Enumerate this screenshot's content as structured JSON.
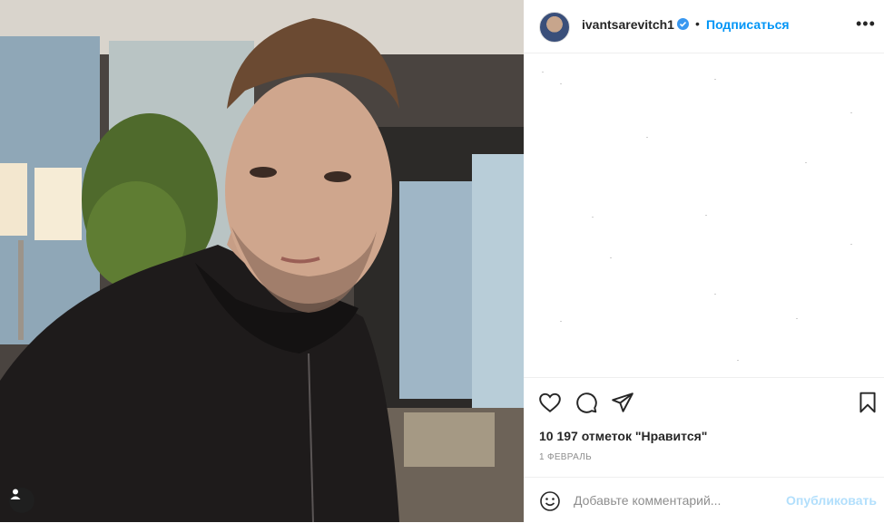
{
  "post": {
    "photo": {
      "description_icon": "person-photo"
    },
    "user_tag_icon": "user-icon"
  },
  "header": {
    "username": "ivantsarevitch1",
    "verified_icon": "verified-badge-icon",
    "separator": "•",
    "follow_label": "Подписаться",
    "more_icon": "more-options-icon",
    "more_label": "•••"
  },
  "actions": {
    "like_icon": "heart-icon",
    "comment_icon": "comment-icon",
    "share_icon": "send-icon",
    "save_icon": "bookmark-icon",
    "likes_text": "10 197 отметок \"Нравится\"",
    "date": "1 ФЕВРАЛЬ"
  },
  "comment": {
    "emoji_icon": "emoji-icon",
    "placeholder": "Добавьте комментарий...",
    "publish_label": "Опубликовать"
  },
  "colors": {
    "accent": "#0095f6",
    "publish_disabled": "#b2dffc",
    "text": "#262626",
    "muted": "#8e8e8e"
  }
}
